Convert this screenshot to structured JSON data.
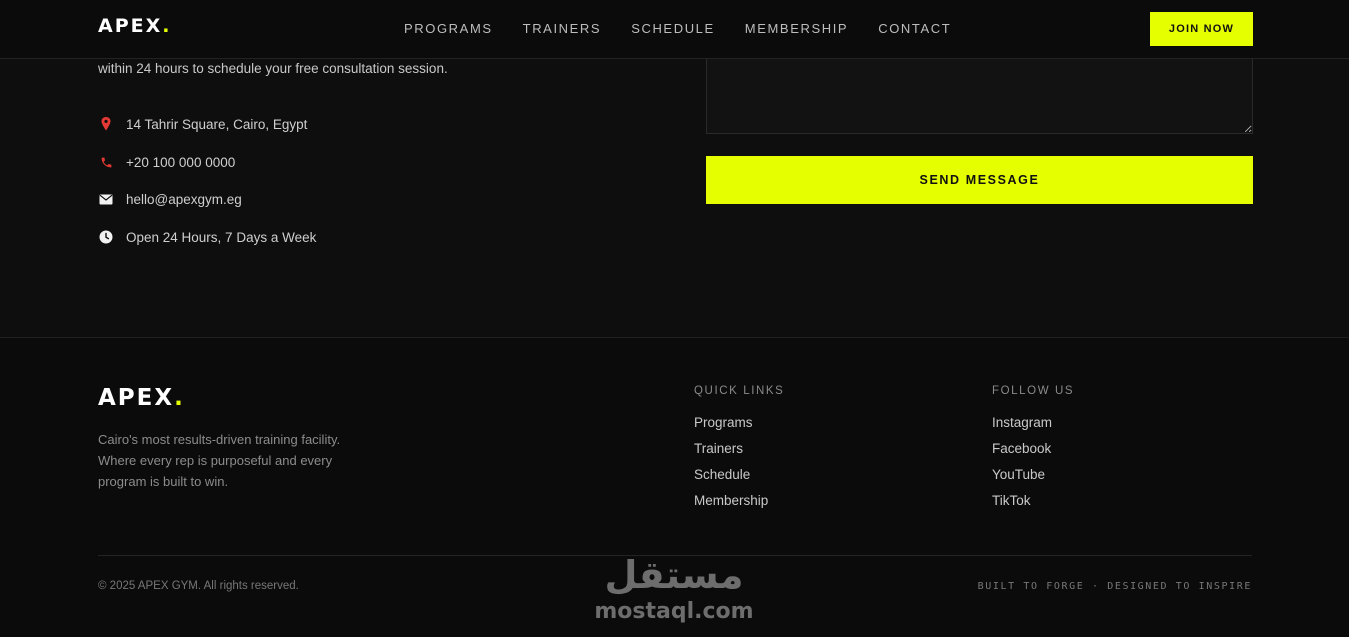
{
  "nav": {
    "logo_text": "APEX",
    "logo_dot": ".",
    "links": [
      "PROGRAMS",
      "TRAINERS",
      "SCHEDULE",
      "MEMBERSHIP",
      "CONTACT"
    ],
    "join_label": "JOIN NOW"
  },
  "contact": {
    "intro": "within 24 hours to schedule your free consultation session.",
    "address": "14 Tahrir Square, Cairo, Egypt",
    "phone": "+20 100 000 0000",
    "email": "hello@apexgym.eg",
    "hours": "Open 24 Hours, 7 Days a Week",
    "send_label": "SEND MESSAGE",
    "icons": [
      "pin-icon",
      "phone-icon",
      "mail-icon",
      "clock-icon"
    ]
  },
  "footer": {
    "logo_text": "APEX",
    "logo_dot": ".",
    "tagline": "Cairo's most results-driven training facility. Where every rep is purposeful and every program is built to win.",
    "quick_links": {
      "title": "QUICK LINKS",
      "items": [
        "Programs",
        "Trainers",
        "Schedule",
        "Membership"
      ]
    },
    "follow_us": {
      "title": "FOLLOW US",
      "items": [
        "Instagram",
        "Facebook",
        "YouTube",
        "TikTok"
      ]
    },
    "copyright": "© 2025 APEX GYM. All rights reserved.",
    "motto": "BUILT TO FORGE · DESIGNED TO INSPIRE"
  },
  "watermark": {
    "arabic": "مستقل",
    "latin": "mostaql.com"
  },
  "colors": {
    "accent": "#e6ff00",
    "background": "#0c0c0c",
    "pin": "#e53935"
  }
}
